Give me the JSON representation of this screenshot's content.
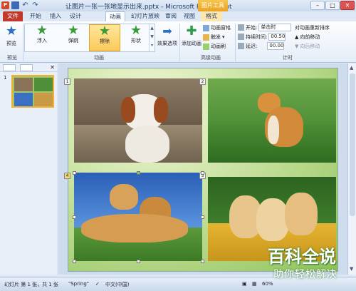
{
  "window": {
    "title": "让图片一张一张地显示出来.pptx - Microsoft PowerPoint",
    "context_tab_group": "图片工具",
    "min": "–",
    "max": "□",
    "close": "✕"
  },
  "tabs": [
    {
      "label": "文件"
    },
    {
      "label": "开始"
    },
    {
      "label": "插入"
    },
    {
      "label": "设计"
    },
    {
      "label": "动画"
    },
    {
      "label": "幻灯片放映"
    },
    {
      "label": "审阅"
    },
    {
      "label": "视图"
    },
    {
      "label": "格式"
    }
  ],
  "ribbon": {
    "preview": {
      "label": "预览",
      "group": "预览"
    },
    "effects": [
      {
        "label": "浮入"
      },
      {
        "label": "弹跳"
      },
      {
        "label": "擦除"
      },
      {
        "label": "形状"
      }
    ],
    "effect_options": "效果选项",
    "animation_group": "动画",
    "add_animation": "添加动画",
    "animation_pane": "动画窗格",
    "trigger": "触发",
    "animation_painter": "动画刷",
    "advanced_group": "高级动画",
    "start_label": "开始:",
    "start_value": "单击时",
    "duration_label": "持续时间:",
    "duration_value": "00.50",
    "delay_label": "延迟:",
    "delay_value": "00.00",
    "reorder_title": "对动画重新排序",
    "move_earlier": "向前移动",
    "move_later": "向后移动",
    "timing_group": "计时"
  },
  "left_panel": {
    "slide_number": "1",
    "close": "✕"
  },
  "slide": {
    "markers": [
      "1",
      "2",
      "4",
      "3"
    ]
  },
  "status": {
    "slide_info": "幻灯片 第 1 张，共 1 张",
    "theme": "\"Spring\"",
    "language": "中文(中国)",
    "zoom": "60%"
  },
  "watermark": {
    "title": "百科全说",
    "subtitle": "助你轻松解决"
  },
  "colors": {
    "file_tab": "#c0392b",
    "selected_effect": "#fbc95a",
    "slide_green": "#8fc25a"
  }
}
